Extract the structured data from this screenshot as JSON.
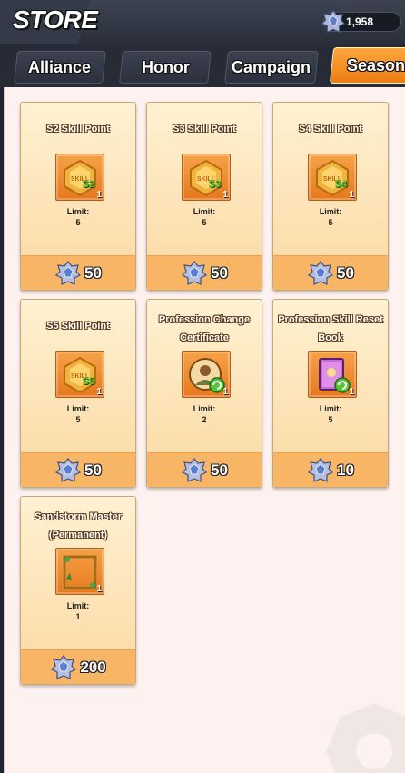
{
  "header": {
    "title": "STORE",
    "currency_value": "1,958"
  },
  "tabs": [
    {
      "label": "Alliance",
      "active": false
    },
    {
      "label": "Honor",
      "active": false
    },
    {
      "label": "Campaign",
      "active": false
    },
    {
      "label": "Season",
      "active": true
    }
  ],
  "items": [
    {
      "name": "S2 Skill Point",
      "badge": "S2",
      "icon": "skill-point-icon",
      "qty": "1",
      "limit_label": "Limit:",
      "limit": "5",
      "price": "50"
    },
    {
      "name": "S3 Skill Point",
      "badge": "S3",
      "icon": "skill-point-icon",
      "qty": "1",
      "limit_label": "Limit:",
      "limit": "5",
      "price": "50"
    },
    {
      "name": "S4 Skill Point",
      "badge": "S4",
      "icon": "skill-point-icon",
      "qty": "1",
      "limit_label": "Limit:",
      "limit": "5",
      "price": "50"
    },
    {
      "name": "S5 Skill Point",
      "badge": "S5",
      "icon": "skill-point-icon",
      "qty": "1",
      "limit_label": "Limit:",
      "limit": "5",
      "price": "50"
    },
    {
      "name": "Profession Change Certificate",
      "icon": "profession-change-icon",
      "qty": "1",
      "limit_label": "Limit:",
      "limit": "2",
      "price": "50"
    },
    {
      "name": "Profession Skill Reset Book",
      "icon": "reset-book-icon",
      "qty": "1",
      "limit_label": "Limit:",
      "limit": "5",
      "price": "10"
    },
    {
      "name": "Sandstorm Master (Permanent)",
      "icon": "frame-icon",
      "qty": "1",
      "limit_label": "Limit:",
      "limit": "1",
      "price": "200"
    }
  ],
  "colors": {
    "accent": "#f0861c",
    "card_bg": "#fde4b8",
    "price_bar": "#f7b565",
    "panel": "#fdf2ef"
  }
}
